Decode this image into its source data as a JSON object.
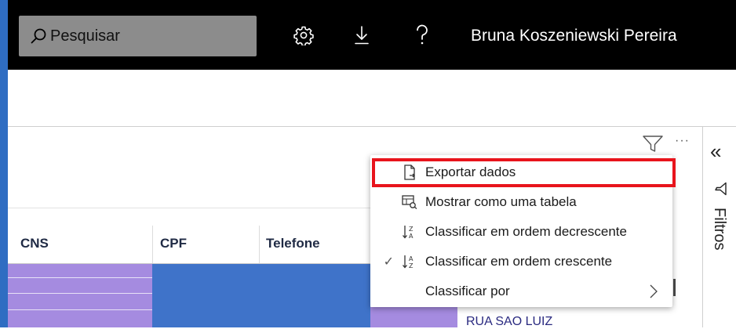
{
  "search": {
    "placeholder": "Pesquisar"
  },
  "header": {
    "user_name": "Bruna Koszeniewski Pereira"
  },
  "table": {
    "columns": [
      "CNS",
      "CPF",
      "Telefone"
    ],
    "visible_cell": "RUA SAO LUIZ"
  },
  "context_menu": {
    "items": [
      {
        "label": "Exportar dados",
        "icon": "export-file-icon",
        "checked": false
      },
      {
        "label": "Mostrar como uma tabela",
        "icon": "table-view-icon",
        "checked": false
      },
      {
        "label": "Classificar em ordem decrescente",
        "icon": "sort-descending-icon",
        "checked": false
      },
      {
        "label": "Classificar em ordem crescente",
        "icon": "sort-ascending-icon",
        "checked": true
      },
      {
        "label": "Classificar por",
        "icon": "",
        "checked": false,
        "has_submenu": true
      }
    ]
  },
  "filters_pane": {
    "title": "Filtros"
  },
  "colors": {
    "topbar": "#000000",
    "accent_blue": "#3f73c9",
    "purple_cell": "#a58be0",
    "highlight_red": "#e8141c"
  }
}
